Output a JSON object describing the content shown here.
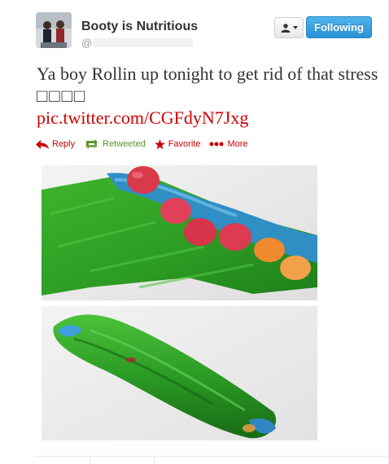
{
  "user": {
    "display_name": "Booty is Nutritious",
    "handle_prefix": "@"
  },
  "buttons": {
    "user_menu_icon": "person-icon",
    "follow_label": "Following"
  },
  "tweet": {
    "text": "Ya boy Rollin up tonight to get rid of that stress",
    "emoji_boxes": "□□□□",
    "link": "pic.twitter.com/CGFdyN7Jxg"
  },
  "actions": {
    "reply": "Reply",
    "retweeted": "Retweeted",
    "favorite": "Favorite",
    "more": "More"
  },
  "colors": {
    "link_red": "#cc0000",
    "retweet_green": "#5c9430",
    "follow_blue": "#2a91d6",
    "text": "#333333"
  }
}
